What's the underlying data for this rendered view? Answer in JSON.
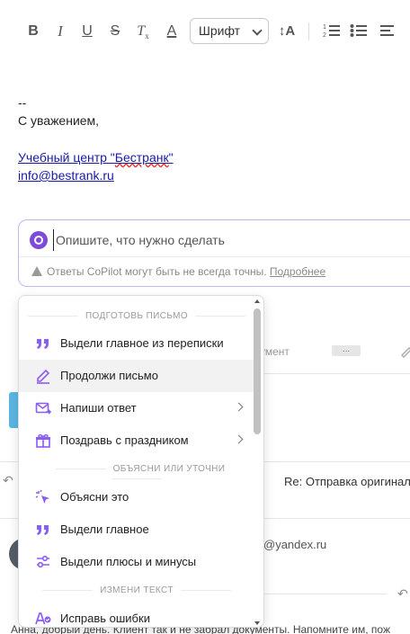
{
  "toolbar": {
    "bold_label": "B",
    "italic_label": "I",
    "underline_label": "U",
    "strike_label": "S",
    "clear_format_label": "T",
    "clear_format_sub": "x",
    "text_color_label": "A",
    "font_select_value": "Шрифт",
    "font_size_label": "↕A"
  },
  "signature": {
    "dashes": "--",
    "regards": "С уважением,",
    "company_prefix": "Учебный центр \"",
    "company_name": "Бестранк",
    "company_suffix": "\"",
    "email": "info@bestrank.ru"
  },
  "copilot": {
    "placeholder": "Опишите, что нужно сделать",
    "warning_text": "Ответы CoPilot могут быть не всегда точны.",
    "more_link": "Подробнее",
    "logo_color": "#7e4bd8",
    "border_color": "#c8b5ec"
  },
  "menu": {
    "sections": [
      {
        "title": "ПОДГОТОВЬ ПИСЬМО"
      },
      {
        "title": "ОБЪЯСНИ ИЛИ УТОЧНИ"
      },
      {
        "title": "ИЗМЕНИ ТЕКСТ"
      }
    ],
    "items": [
      {
        "label": "Выдели главное из переписки",
        "icon": "quote-icon"
      },
      {
        "label": "Продолжи письмо",
        "icon": "pen-icon",
        "hovered": true
      },
      {
        "label": "Напиши ответ",
        "icon": "mail-reply-icon",
        "submenu": true
      },
      {
        "label": "Поздравь с праздником",
        "icon": "gift-icon",
        "submenu": true
      },
      {
        "label": "Объясни это",
        "icon": "cursor-sparkle-icon"
      },
      {
        "label": "Выдели главное",
        "icon": "quote-icon"
      },
      {
        "label": "Выдели плюсы и минусы",
        "icon": "sliders-icon"
      },
      {
        "label": "Исправь ошибки",
        "icon": "spellcheck-icon"
      }
    ],
    "icon_color": "#8b5cf6"
  },
  "background": {
    "partial_document": "умент",
    "dots": "...",
    "subject": "Re: Отправка оригинал",
    "email_partial": "@yandex.ru",
    "body_preview": "Анна, добрый день. Клиент так и не забрал документы. Напомните им, пож"
  }
}
